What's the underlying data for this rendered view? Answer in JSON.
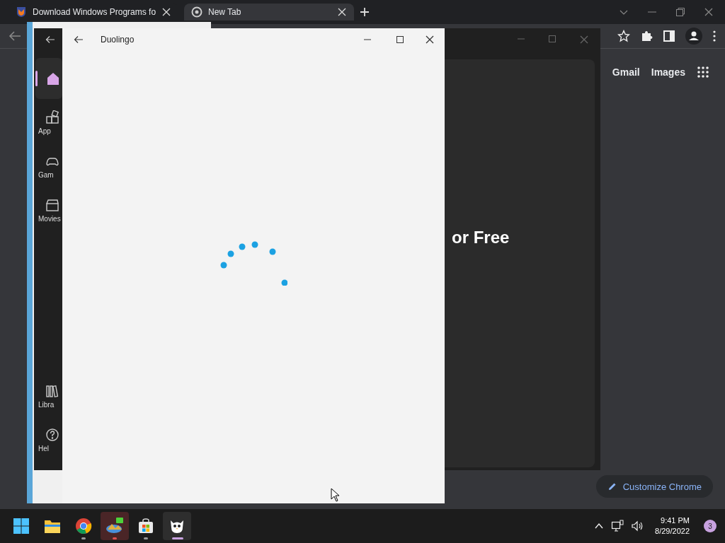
{
  "browser": {
    "tabs": [
      {
        "title": "Download Windows Programs fo",
        "selected": false
      },
      {
        "title": "New Tab",
        "selected": true
      }
    ],
    "links": [
      "Gmail",
      "Images"
    ],
    "customize_button": "Customize Chrome"
  },
  "store_window": {
    "nav_items": [
      {
        "kind": "home",
        "selected": true
      },
      {
        "kind": "apps",
        "label": "App",
        "selected": false
      },
      {
        "kind": "gaming",
        "label": "Gam",
        "selected": false
      },
      {
        "kind": "movies",
        "label": "Movies",
        "selected": false
      }
    ],
    "bottom_items": [
      {
        "kind": "library",
        "label": "Libra",
        "selected": false
      },
      {
        "kind": "help",
        "label": "Hel",
        "selected": false
      }
    ],
    "headline": "or Free"
  },
  "duolingo_window": {
    "title": "Duolingo"
  },
  "taskbar": {
    "apps": [
      {
        "kind": "start",
        "running": false,
        "attention": false,
        "selected": false
      },
      {
        "kind": "explorer",
        "running": false,
        "attention": false,
        "selected": false
      },
      {
        "kind": "chrome",
        "running": true,
        "attention": false,
        "selected": false
      },
      {
        "kind": "photo-app",
        "running": true,
        "attention": true,
        "selected": false
      },
      {
        "kind": "store",
        "running": true,
        "attention": false,
        "selected": false
      },
      {
        "kind": "duolingo",
        "running": true,
        "attention": false,
        "selected": true
      }
    ],
    "time": "9:41 PM",
    "date": "8/29/2022",
    "notification_count": "3"
  }
}
